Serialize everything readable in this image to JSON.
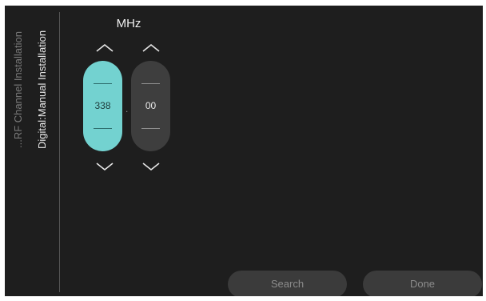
{
  "breadcrumb": {
    "previous": "...RF Channel Installation",
    "current": "Digital:Manual Installation"
  },
  "frequency": {
    "unit": "MHz",
    "integer_value": "338",
    "separator": ".",
    "decimal_value": "00"
  },
  "actions": {
    "search_label": "Search",
    "done_label": "Done"
  },
  "icons": {
    "increase": "chevron-up-icon",
    "decrease": "chevron-down-icon"
  },
  "colors": {
    "background": "#1e1e1e",
    "active_spinner": "#73d2d0",
    "inactive_spinner": "#3e3e3e",
    "button": "#3b3b3b"
  }
}
